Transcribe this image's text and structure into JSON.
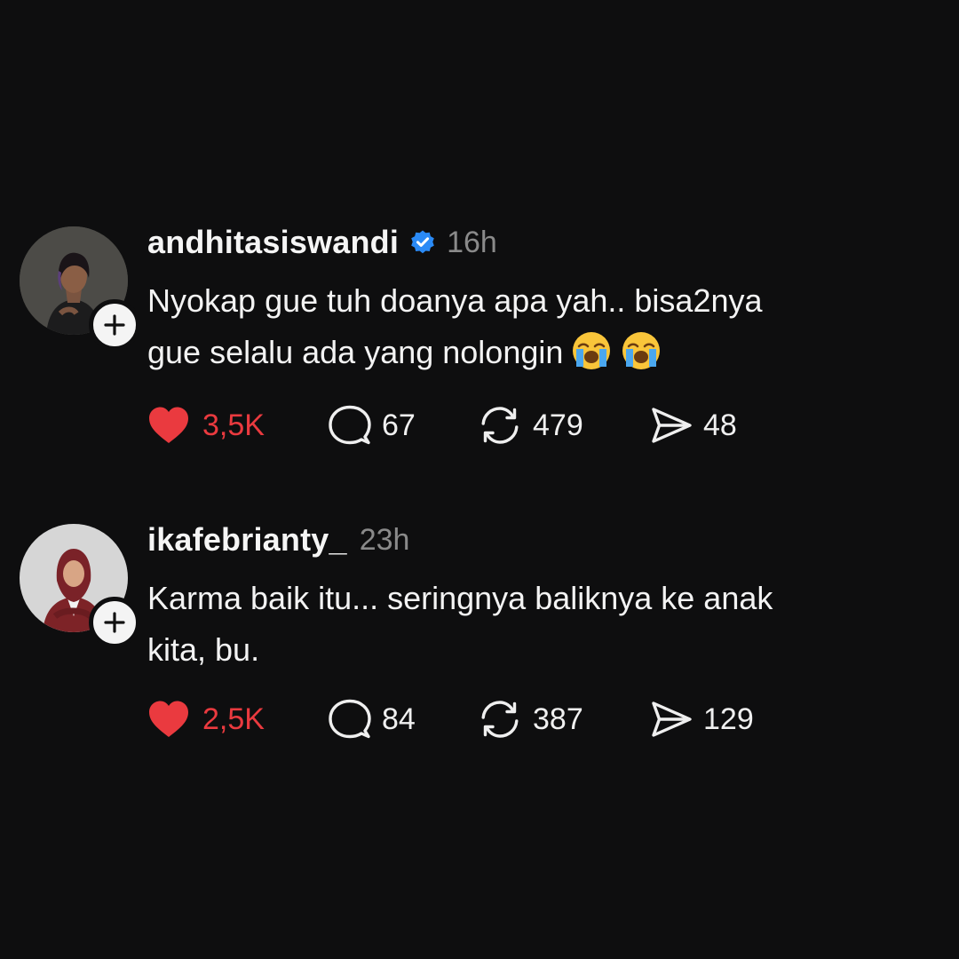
{
  "posts": [
    {
      "username": "andhitasiswandi",
      "verified": true,
      "time": "16h",
      "text": "Nyokap gue tuh doanya apa yah.. bisa2nya\ngue selalu ada yang nolongin",
      "emoji": [
        "crying-face",
        "crying-face"
      ],
      "likes": "3,5K",
      "comments": "67",
      "reposts": "479",
      "shares": "48"
    },
    {
      "username": "ikafebrianty_",
      "verified": false,
      "time": "23h",
      "text": "Karma baik itu... seringnya baliknya ke anak\nkita, bu.",
      "emoji": [],
      "likes": "2,5K",
      "comments": "84",
      "reposts": "387",
      "shares": "129"
    }
  ],
  "colors": {
    "background": "#0e0e0f",
    "like": "#ea3a3f",
    "verified": "#2a8af6",
    "muted": "#8a8a8a"
  }
}
